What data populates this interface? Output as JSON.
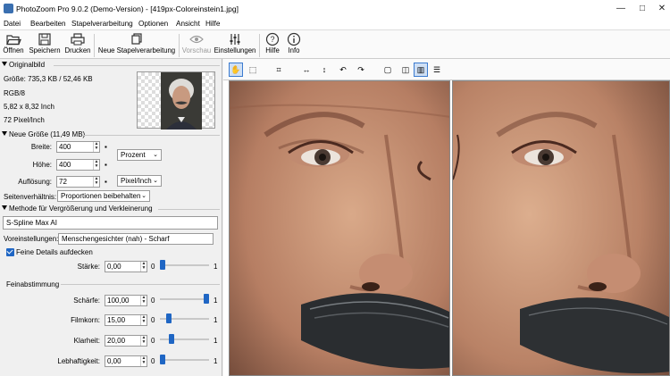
{
  "window": {
    "title": "PhotoZoom Pro 9.0.2 (Demo-Version) - [419px-Coloreinstein1.jpg]"
  },
  "menu": [
    "Datei",
    "Bearbeiten",
    "Stapelverarbeitung",
    "Optionen",
    "Ansicht",
    "Hilfe"
  ],
  "toolbar": {
    "open": "Öffnen",
    "save": "Speichern",
    "print": "Drucken",
    "batch": "Neue Stapelverarbeitung",
    "preview": "Vorschau",
    "settings": "Einstellungen",
    "help": "Hilfe",
    "info": "Info"
  },
  "original": {
    "header": "Originalbild",
    "size": "Größe: 735,3 KB / 52,46 KB",
    "mode": "RGB/8",
    "dims": "5,82 x 8,32 Inch",
    "res": "72 Pixel/Inch"
  },
  "new_size": {
    "header": "Neue Größe (11,49 MB)",
    "width_label": "Breite:",
    "width_value": "400",
    "height_label": "Höhe:",
    "height_value": "400",
    "res_label": "Auflösung:",
    "res_value": "72",
    "unit": "Prozent",
    "res_unit": "Pixel/Inch",
    "aspect_label": "Seitenverhältnis:",
    "aspect_value": "Proportionen beibehalten"
  },
  "method": {
    "header": "Methode für Vergrößerung und Verkleinerung",
    "value": "S-Spline Max AI",
    "preset_label": "Voreinstellungen:",
    "preset_value": "Menschengesichter (nah) - Scharf",
    "fine_details": "Feine Details aufdecken",
    "strength_label": "Stärke:",
    "strength_value": "0,00",
    "min": "0",
    "max": "1"
  },
  "tuning": {
    "header": "Feinabstimmung",
    "rows": [
      {
        "label": "Schärfe:",
        "value": "100,00",
        "level": 1.0
      },
      {
        "label": "Filmkorn:",
        "value": "15,00",
        "level": 0.15
      },
      {
        "label": "Klarheit:",
        "value": "20,00",
        "level": 0.2
      },
      {
        "label": "Lebhaftigkeit:",
        "value": "0,00",
        "level": 0.0
      }
    ],
    "min": "0",
    "max": "1"
  },
  "strength_level": 0.0,
  "colors": {
    "accent": "#1f66c4"
  }
}
